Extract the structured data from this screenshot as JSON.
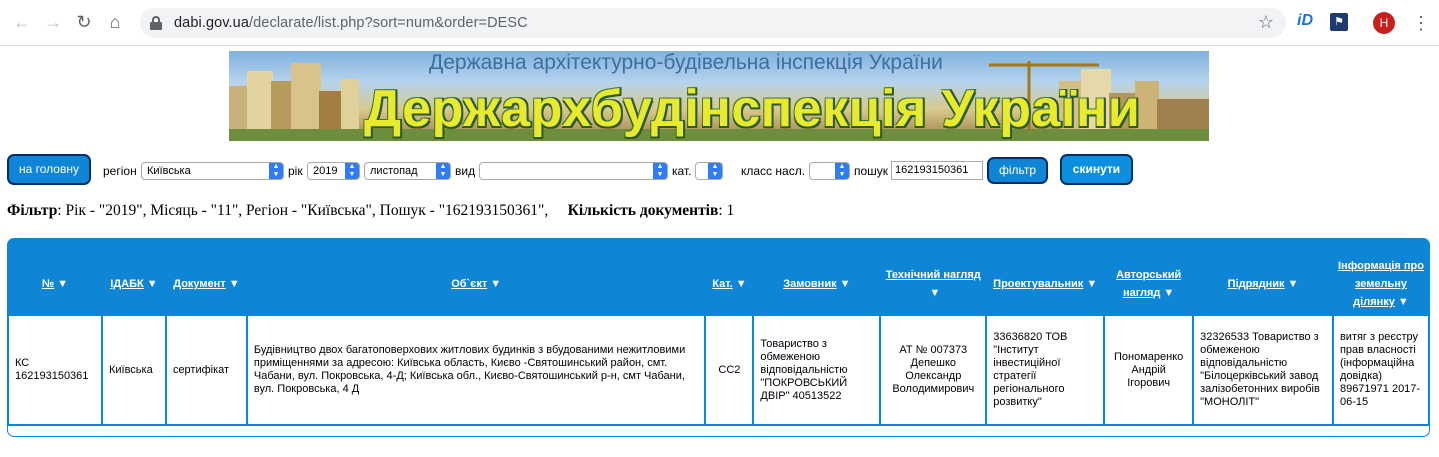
{
  "browser": {
    "url_host": "dabi.gov.ua",
    "url_path": "/declarate/list.php?sort=num&order=DESC",
    "ext_id_label": "iD",
    "avatar_letter": "H"
  },
  "banner": {
    "subtitle": "Державна архітектурно-будівельна інспекція України",
    "title": "Держархбудінспекція України"
  },
  "filters": {
    "home_button": "на головну",
    "region_label": "регіон",
    "region_value": "Київська",
    "year_label": "рік",
    "year_value": "2019",
    "month_value": "листопад",
    "type_label": "вид",
    "type_value": "",
    "category_label": "кат.",
    "category_value": "",
    "class_label": "класс насл.",
    "class_value": "",
    "search_label": "пошук",
    "search_value": "162193150361",
    "filter_button": "фільтр",
    "reset_button": "скинути"
  },
  "summary": {
    "filter_label": "Фільтр",
    "filter_text": ": Рік - \"2019\", Місяць - \"11\", Регіон - \"Київська\", Пошук - \"162193150361\",",
    "count_label": "Кількість документів",
    "count_value": ": 1"
  },
  "table": {
    "headers": [
      "№",
      "ІДАБК",
      "Документ",
      "Об`єкт",
      "Кат.",
      "Замовник",
      "Технічний нагляд",
      "Проектувальник",
      "Авторський нагляд",
      "Підрядник",
      "Інформація про земельну ділянку"
    ],
    "rows": [
      {
        "num": "КС 162193150361",
        "idabk": "Київська",
        "document": "сертифікат",
        "object": "Будівництво двох багатоповерхових житлових будинків з вбудованими нежитловими приміщеннями за адресою: Київська область, Києво -Святошинський район, смт. Чабани, вул. Покровська, 4-Д; Київська обл., Києво-Святошинський р-н, смт Чабани, вул. Покровська, 4 Д",
        "category": "СС2",
        "customer": "Товариство з обмеженою відповідальністю \"ПОКРОВСЬКИЙ ДВІР\" 40513522",
        "tech_supervision": "АТ № 007373 Депешко Олександр Володимирович",
        "designer": "33636820 ТОВ \"Інститут інвестиційної стратегії регіонального розвитку\"",
        "author_supervision": "Пономаренко Андрій Ігорович",
        "contractor": "32326533 Товариство з обмеженою відповідальністю \"Білоцерківський завод залізобетонних виробів \"МОНОЛІТ\"",
        "land_info": "витяг з реєстру прав власності (інформаційна довідка) 89671971 2017-06-15"
      }
    ]
  }
}
